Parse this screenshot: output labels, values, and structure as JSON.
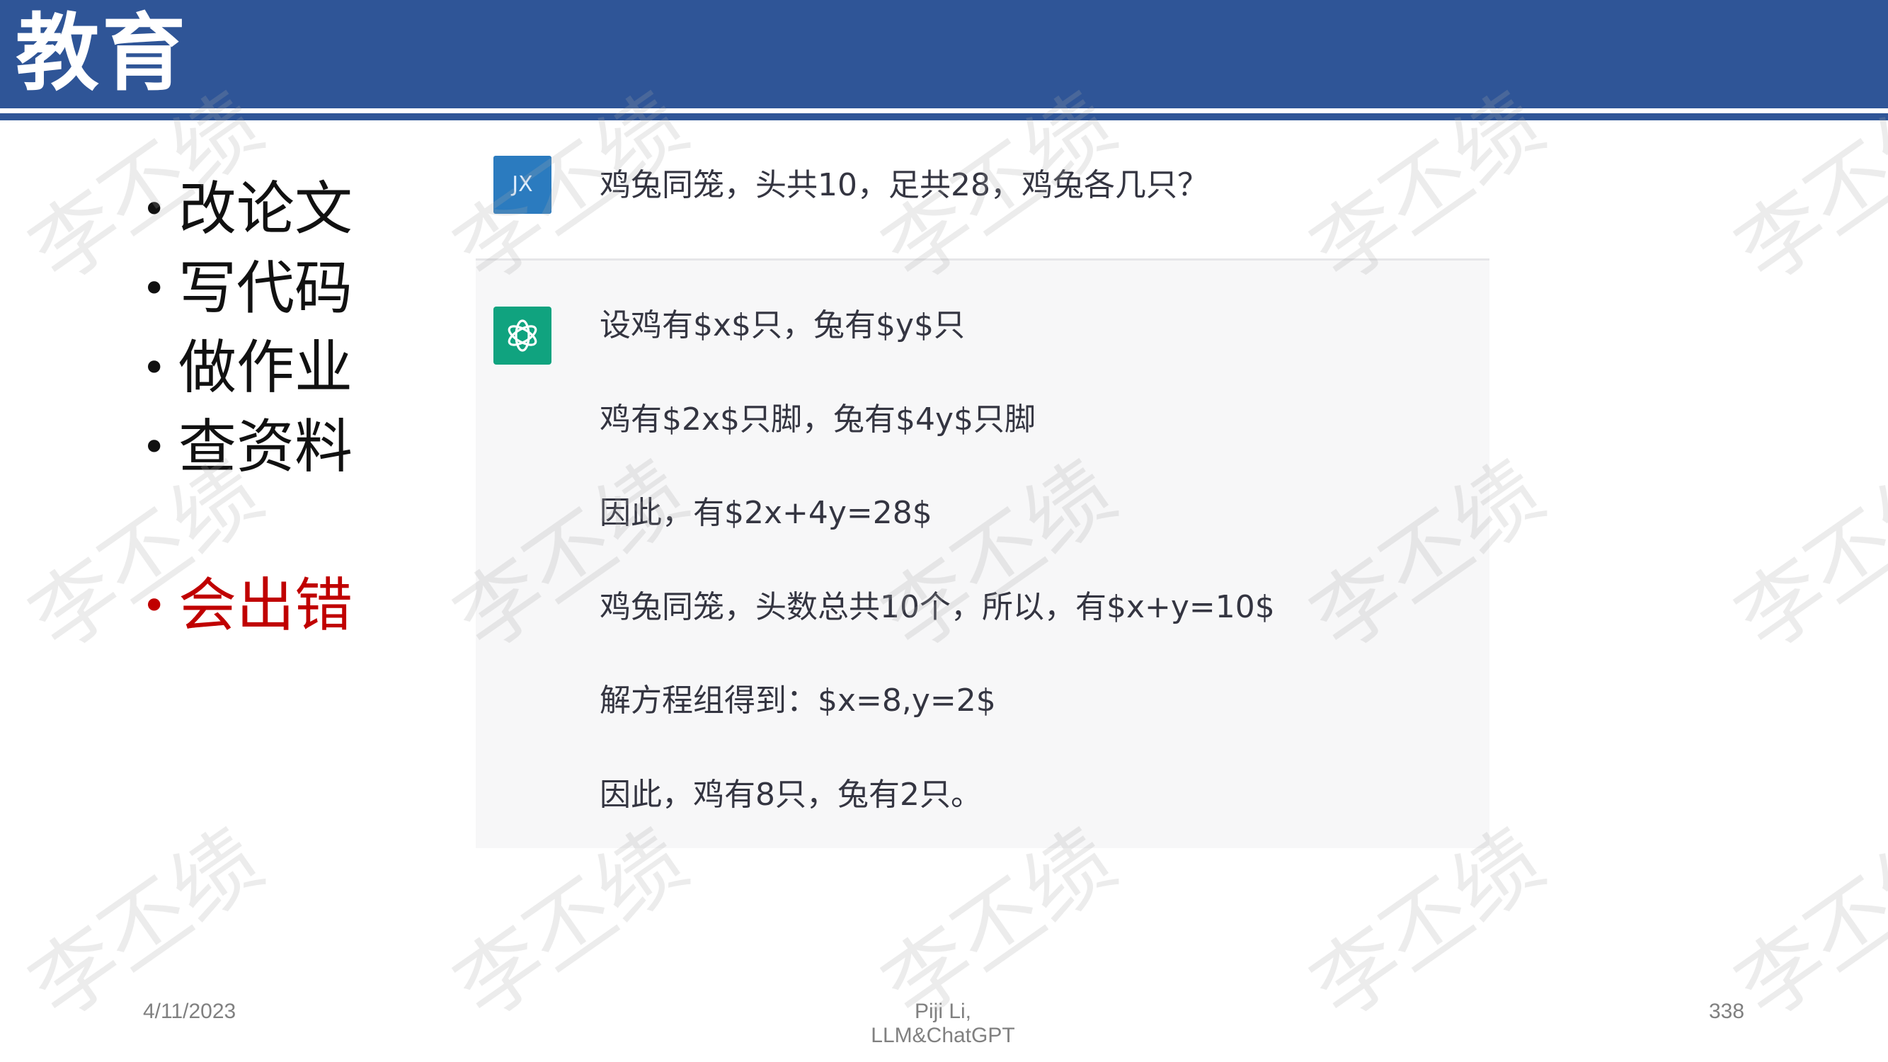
{
  "header": {
    "title": "教育"
  },
  "bullets": {
    "items": [
      "改论文",
      "写代码",
      "做作业",
      "查资料"
    ],
    "highlight": "会出错",
    "bullet_symbol": "•",
    "highlight_color": "#c00000"
  },
  "chat": {
    "user_avatar_initials": "JX",
    "user_question": "鸡兔同笼，头共10，足共28，鸡兔各几只？",
    "bot_icon": "openai-logo-icon",
    "answer_lines": [
      "设鸡有$x$只，兔有$y$只",
      "鸡有$2x$只脚，兔有$4y$只脚",
      "因此，有$2x+4y=28$",
      "鸡兔同笼，头数总共10个，所以，有$x+y=10$",
      "解方程组得到：$x=8,y=2$",
      "因此，鸡有8只，兔有2只。"
    ]
  },
  "footer": {
    "date": "4/11/2023",
    "center": "Piji Li, LLM&ChatGPT",
    "page": "338"
  },
  "watermark_text": "李丕绩",
  "colors": {
    "header_bg": "#2f5597",
    "bot_bg": "#f7f7f8",
    "user_avatar": "#2b7bbf",
    "bot_avatar": "#10a37f"
  }
}
